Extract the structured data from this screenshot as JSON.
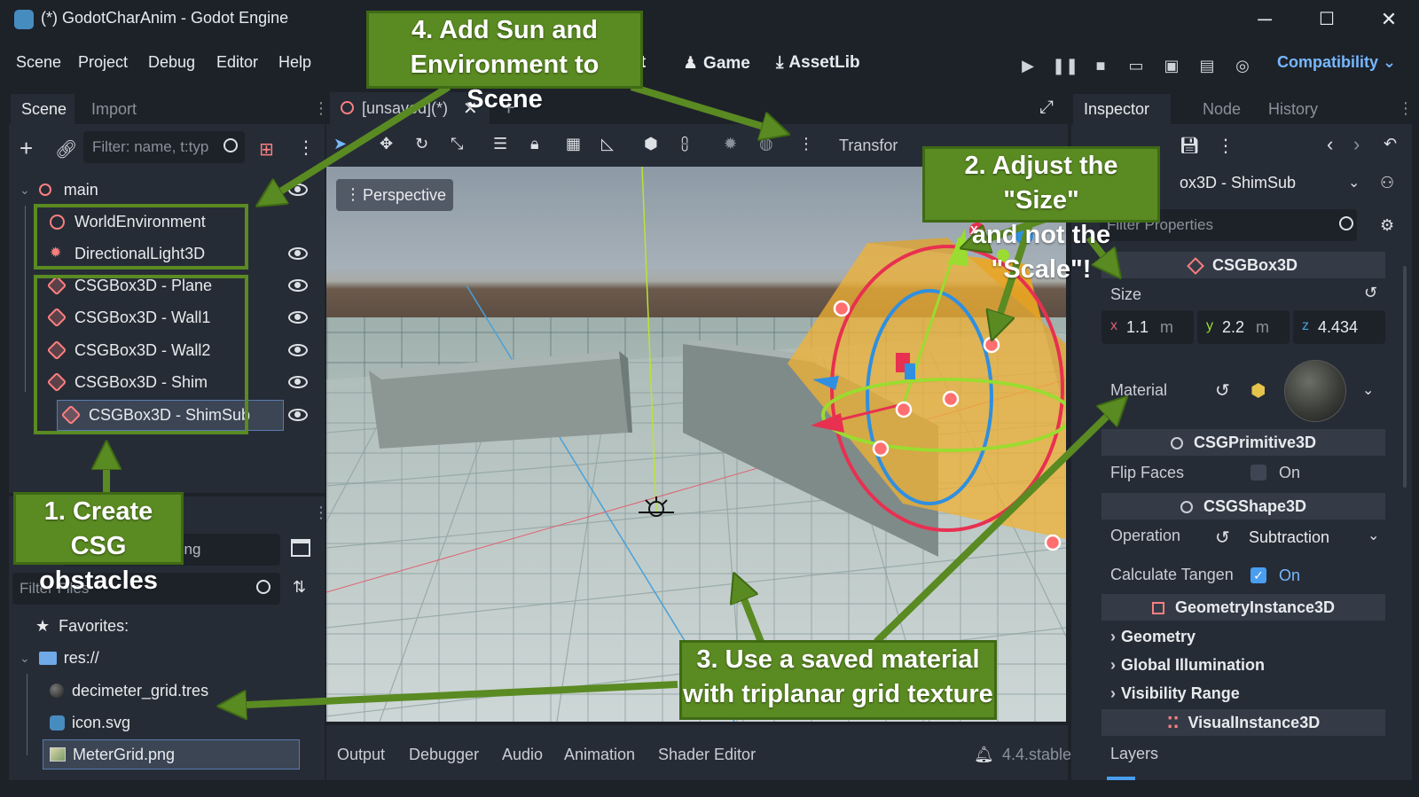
{
  "window": {
    "title": "(*) GodotCharAnim - Godot Engine",
    "minimize": "─",
    "maximize": "☐",
    "close": "✕"
  },
  "menu": [
    "Scene",
    "Project",
    "Debug",
    "Editor",
    "Help"
  ],
  "top_tabs": {
    "script": "ipt",
    "game": "Game",
    "assetlib": "AssetLib"
  },
  "renderer": "Compatibility ⌄",
  "scene_dock": {
    "tabs": [
      "Scene",
      "Import"
    ],
    "filter_placeholder": "Filter: name, t:typ",
    "root": "main",
    "items": [
      "WorldEnvironment",
      "DirectionalLight3D",
      "CSGBox3D - Plane",
      "CSGBox3D - Wall1",
      "CSGBox3D - Wall2",
      "CSGBox3D - Shim",
      "CSGBox3D - ShimSub"
    ]
  },
  "filesystem_dock": {
    "path": "res://MeterGrid.png",
    "filter_placeholder": "Filter Files",
    "favorites": "Favorites:",
    "res": "res://",
    "files": [
      "decimeter_grid.tres",
      "icon.svg",
      "MeterGrid.png"
    ]
  },
  "viewport": {
    "tab_label": "[unsaved](*)",
    "perspective": "Perspective",
    "transform_label": "Transfor",
    "gizmo_x": "X"
  },
  "bottom_panel": {
    "tabs": [
      "Output",
      "Debugger",
      "Audio",
      "Animation",
      "Shader Editor"
    ],
    "version": "4.4.stable"
  },
  "inspector": {
    "tabs": [
      "Inspector",
      "Node",
      "History"
    ],
    "object": "ox3D - ShimSub",
    "filter_placeholder": "Filter Properties",
    "section_csgbox": "CSGBox3D",
    "size_label": "Size",
    "size": {
      "x": "1.1",
      "y": "2.2",
      "z": "4.434",
      "unit": "m"
    },
    "material_label": "Material",
    "section_primitive": "CSGPrimitive3D",
    "flip_faces_label": "Flip Faces",
    "flip_faces_value": "On",
    "section_shape": "CSGShape3D",
    "operation_label": "Operation",
    "operation_value": "Subtraction",
    "calc_tangents_label": "Calculate Tangen",
    "calc_tangents_value": "On",
    "section_geometry": "GeometryInstance3D",
    "categories": [
      "Geometry",
      "Global Illumination",
      "Visibility Range"
    ],
    "section_visual": "VisualInstance3D",
    "layers_label": "Layers"
  },
  "callouts": {
    "c1": [
      "1. Create CSG",
      "obstacles"
    ],
    "c2": [
      "2. Adjust the \"Size\"",
      "and not the \"Scale\"!"
    ],
    "c3": [
      "3. Use a saved material",
      "with triplanar grid texture"
    ],
    "c4": [
      "4. Add Sun and",
      "Environment to Scene"
    ]
  },
  "colors": {
    "accent": "#77b7ff",
    "callout_green": "#5a8a22",
    "csg_red": "#fc7f7f",
    "shim_orange": "#f2b233"
  }
}
